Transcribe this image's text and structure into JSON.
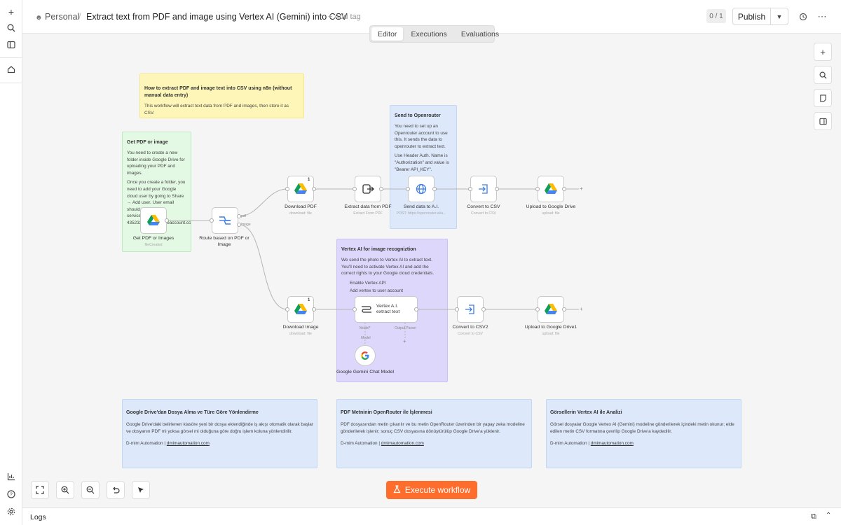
{
  "app": {
    "breadcrumb_project": "Personal",
    "workflow_title": "Extract text from PDF and image using Vertex AI (Gemini) into CSV",
    "add_tag": "+ Add tag",
    "counter": "0 / 1",
    "publish_label": "Publish"
  },
  "tabs": [
    {
      "label": "Editor",
      "active": true
    },
    {
      "label": "Executions",
      "active": false
    },
    {
      "label": "Evaluations",
      "active": false
    }
  ],
  "notes": {
    "intro": {
      "title": "How to extract PDF and image text into CSV using n8n (without manual data entry)",
      "body": "This workflow will extract text data from PDF and images, then store it as CSV."
    },
    "get_pdf": {
      "title": "Get PDF or image",
      "p1": "You need to create a new folder inside Google Drive for uploading your PDF and images.",
      "p2": "Once you create a folder, you need to add your Google cloud user by going to Share → Add user. User email should be like this: serviceaccount-435232...com.serviceaccount.com"
    },
    "openrouter": {
      "title": "Send to Openrouter",
      "p1": "You need to set up an Openrouter account to use this. It sends the data to openrouter to extract text.",
      "p2": "Use Header Auth. Name is \"Authorization\" and value is \"Bearer API_KEY\"."
    },
    "vertex": {
      "title": "Vertex AI for image recogniztion",
      "p1": "We send the photo to Vertex AI to extract text. You'll need to activate Vertex AI and add the correct rights to your Google cloud credentials.",
      "item1": "Enable Vertex API",
      "item2": "Add vertex to user account"
    }
  },
  "bottom_notes": [
    {
      "title": "Google Drive'dan Dosya Alma ve Türe Göre Yönlendirme",
      "body": "Google Drive'daki belirlenen klasöre yeni bir dosya eklendiğinde iş akışı otomatik olarak başlar ve dosyanın PDF mi yoksa görsel mi olduğuna göre doğru işlem koluna yönlendirilir.",
      "author": "D-mim Automation | ",
      "link": "dmimautomation.com"
    },
    {
      "title": "PDF Metninin OpenRouter ile İşlenmesi",
      "body": "PDF dosyasından metin çıkarılır ve bu metin OpenRouter üzerinden bir yapay zeka modeline gönderilerek işlenir; sonuç CSV dosyasına dönüştürülüp Google Drive'a yüklenir.",
      "author": "D-mim Automation | ",
      "link": "dmimautomation.com"
    },
    {
      "title": "Görsellerin Vertex AI ile Analizi",
      "body": "Görsel dosyalar Google Vertex AI (Gemini) modeline gönderilerek içindeki metin okunur; elde edilen metin CSV formatına çevrilip Google Drive'a kaydedilir.",
      "author": "D-mim Automation | ",
      "link": "dmimautomation.com"
    }
  ],
  "nodes": {
    "trigger": {
      "label": "Get PDF or Images",
      "sub": "fileCreated"
    },
    "switch": {
      "label": "Route based on PDF or Image",
      "out1": "pdf",
      "out2": "image"
    },
    "download_pdf": {
      "label": "Download PDF",
      "sub": "download: file",
      "badge": "1"
    },
    "extract": {
      "label": "Extract data from PDF",
      "sub": "Extract From PDF"
    },
    "send_ai": {
      "label": "Send data to A.I.",
      "sub": "POST: https://openrouter.ai/a..."
    },
    "convert_csv": {
      "label": "Convert to CSV",
      "sub": "Convert to CSV"
    },
    "upload_drive": {
      "label": "Upload to Google Drive",
      "sub": "upload: file"
    },
    "download_image": {
      "label": "Download Image",
      "sub": "download: file",
      "badge": "1"
    },
    "vertex": {
      "label": "Vertex A.I. extract text",
      "port_model": "Model*",
      "port_parser": "Output Parser"
    },
    "convert_csv2": {
      "label": "Convert to CSV2",
      "sub": "Convert to CSV"
    },
    "upload_drive1": {
      "label": "Upload to Google Drive1",
      "sub": "upload: file"
    },
    "gemini": {
      "label": "Google Gemini Chat Model",
      "model_tag": "Model"
    }
  },
  "footer": {
    "execute_label": "Execute workflow",
    "logs_label": "Logs"
  },
  "colors": {
    "accent": "#ff6d2d",
    "yellow_note": "#fdf6b8",
    "green_note": "#e3f9e4",
    "blue_note": "#dde9fb",
    "purple_note": "#ddd7fb"
  }
}
